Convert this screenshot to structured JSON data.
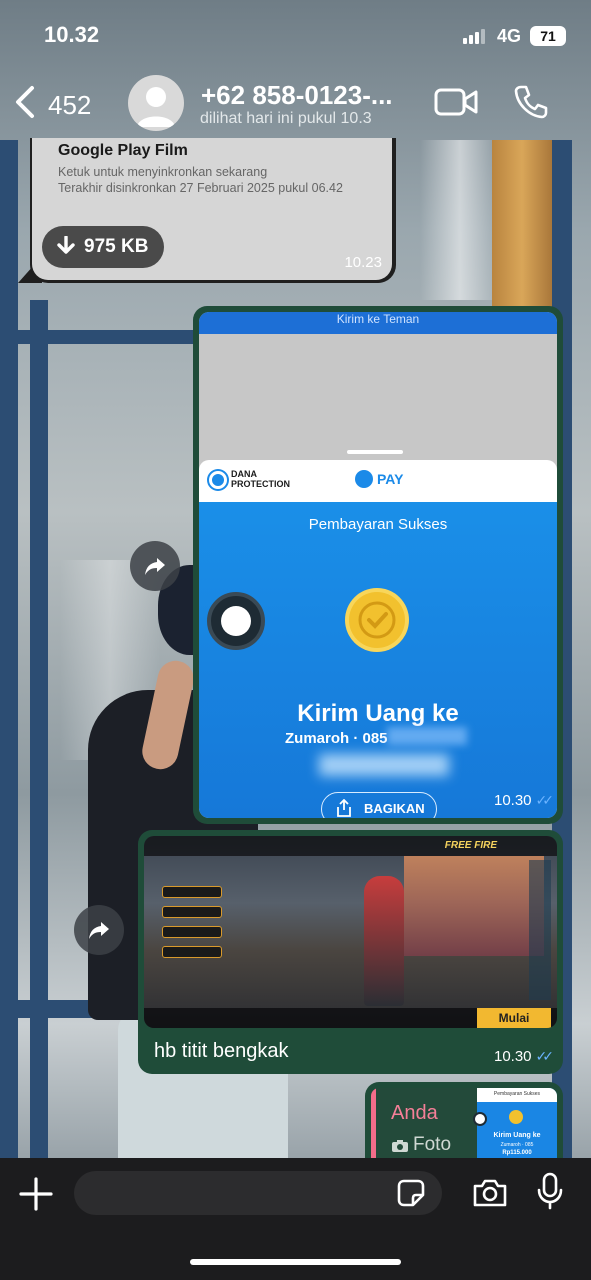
{
  "status_bar": {
    "time": "10.32",
    "network": "4G",
    "battery": "71"
  },
  "header": {
    "back_count": "452",
    "contact_name": "+62 858-0123-...",
    "last_seen": "dilihat hari ini pukul 10.3"
  },
  "messages": {
    "file": {
      "title": "Google Play Film",
      "subtitle_line1": "Ketuk untuk menyinkronkan sekarang",
      "subtitle_line2": "Terakhir disinkronkan 27 Februari 2025 pukul 06.42",
      "download_size": "975 KB",
      "time": "10.23"
    },
    "payment": {
      "top_text": "Kirim ke Teman",
      "dana_protection": "DANA PROTECTION",
      "pay_label": "PAY",
      "status": "Pembayaran Sukses",
      "heading": "Kirim Uang ke",
      "recipient": "Zumaroh · 085",
      "share_label": "BAGIKAN",
      "time": "10.30"
    },
    "game": {
      "logo": "FREE FIRE",
      "start_label": "Mulai",
      "caption": "hb titit bengkak",
      "time": "10.30"
    },
    "reply": {
      "author": "Anda",
      "type": "Foto",
      "thumb_title": "Pembayaran Sukses",
      "thumb_heading": "Kirim Uang ke",
      "thumb_recipient": "Zumaroh · 085",
      "thumb_amount": "Rp115.000"
    }
  },
  "colors": {
    "outgoing_bubble": "#1f4c39",
    "incoming_bubble": "#1f1f1f",
    "read_ticks": "#6bb3ff",
    "reply_author": "#f57f98",
    "dana_blue": "#1a8fe8"
  },
  "icons": [
    "back-chevron-icon",
    "avatar-icon",
    "video-call-icon",
    "phone-icon",
    "download-icon",
    "forward-icon",
    "view-once-icon",
    "share-icon",
    "plus-icon",
    "sticker-icon",
    "camera-icon",
    "mic-icon"
  ]
}
